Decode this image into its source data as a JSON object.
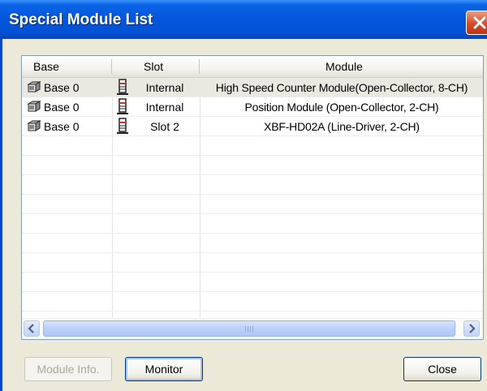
{
  "window": {
    "title": "Special Module List"
  },
  "columns": [
    "Base",
    "Slot",
    "Module"
  ],
  "rows": [
    {
      "base": "Base 0",
      "slot": "Internal",
      "module": "High Speed Counter Module(Open-Collector, 8-CH)",
      "selected": true
    },
    {
      "base": "Base 0",
      "slot": "Internal",
      "module": "Position Module (Open-Collector, 2-CH)",
      "selected": false
    },
    {
      "base": "Base 0",
      "slot": "Slot 2",
      "module": "XBF-HD02A (Line-Driver, 2-CH)",
      "selected": false
    }
  ],
  "buttons": {
    "module_info": "Module Info.",
    "monitor": "Monitor",
    "close": "Close"
  },
  "icons": {
    "base": "base-cube-icon",
    "slot": "slot-module-icon"
  }
}
